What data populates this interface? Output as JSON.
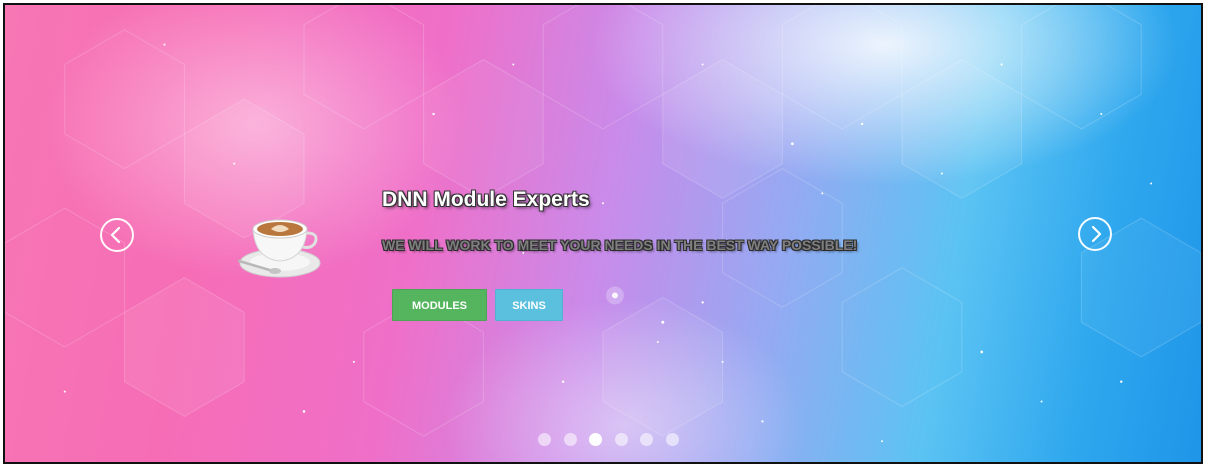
{
  "slide": {
    "title": "DNN Module Experts",
    "subtitle": "WE WILL WORK TO MEET YOUR NEEDS IN THE BEST WAY POSSIBLE!",
    "buttons": {
      "modules_label": "MODULES",
      "skins_label": "SKINS"
    },
    "image_icon": "coffee-cup-icon"
  },
  "navigation": {
    "prev_icon": "chevron-left-circle-icon",
    "next_icon": "chevron-right-circle-icon"
  },
  "pagination": {
    "total": 6,
    "active_index": 2
  },
  "colors": {
    "modules_button": "#55b55f",
    "skins_button": "#5bc0de",
    "background_left": "#f776b4",
    "background_right": "#1f95e8"
  }
}
